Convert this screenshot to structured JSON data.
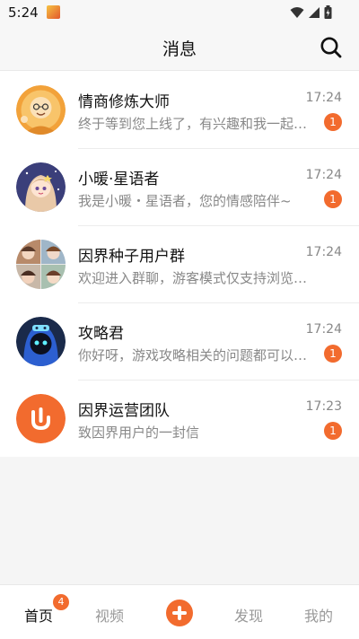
{
  "status_bar": {
    "time": "5:24"
  },
  "header": {
    "title": "消息"
  },
  "conversations": [
    {
      "name": "情商修炼大师",
      "preview": "终于等到您上线了，有兴趣和我一起…",
      "time": "17:24",
      "unread": "1",
      "avatar_icon": "monk-avatar"
    },
    {
      "name": "小暖·星语者",
      "preview": "我是小暖・星语者，您的情感陪伴~",
      "time": "17:24",
      "unread": "1",
      "avatar_icon": "girl-avatar"
    },
    {
      "name": "因界种子用户群",
      "preview": "欢迎进入群聊，游客模式仅支持浏览消息",
      "time": "17:24",
      "unread": "",
      "avatar_icon": "group-avatar"
    },
    {
      "name": "攻略君",
      "preview": "你好呀，游戏攻略相关的问题都可以…",
      "time": "17:24",
      "unread": "1",
      "avatar_icon": "hooded-avatar"
    },
    {
      "name": "因界运营团队",
      "preview": "致因界用户的一封信",
      "time": "17:23",
      "unread": "1",
      "avatar_icon": "brand-logo-avatar"
    }
  ],
  "bottom_nav": {
    "home": "首页",
    "home_badge": "4",
    "video": "视频",
    "discover": "发现",
    "mine": "我的"
  },
  "colors": {
    "accent": "#f26b2e",
    "badge_text": "#ffffff"
  }
}
